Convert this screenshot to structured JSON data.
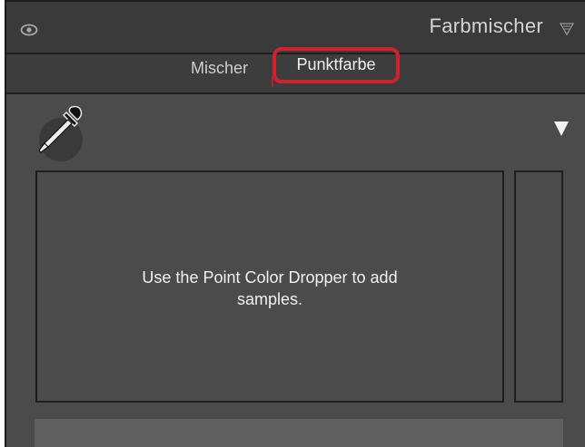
{
  "panel": {
    "title": "Farbmischer",
    "visibility_icon": "eye-icon",
    "collapse_icon": "collapse-triangle-icon"
  },
  "tabs": [
    {
      "label": "Mischer",
      "active": false
    },
    {
      "label": "Punktfarbe",
      "active": true
    }
  ],
  "tools": {
    "dropper_icon": "eyedropper-icon",
    "menu_icon": "dropdown-triangle-icon"
  },
  "samples": {
    "empty_message": "Use the Point Color Dropper to add samples."
  },
  "colors": {
    "panel_bg": "#4b4b4b",
    "header_bg": "#3a3a3a",
    "highlight": "#d0212f",
    "text": "#f1f1f1"
  }
}
